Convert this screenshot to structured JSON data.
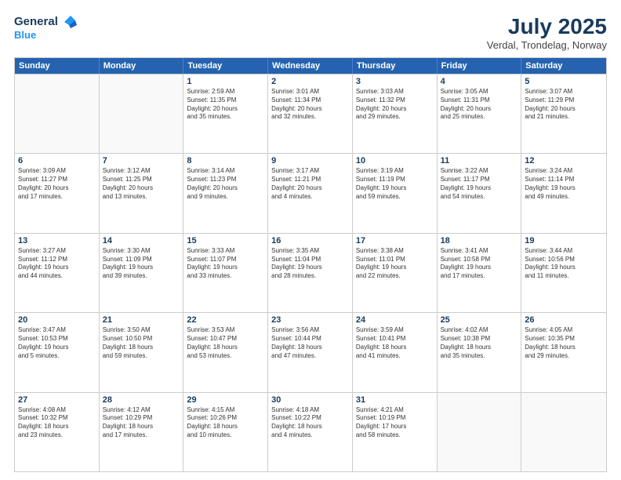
{
  "header": {
    "logo_line1": "General",
    "logo_line2": "Blue",
    "month": "July 2025",
    "location": "Verdal, Trondelag, Norway"
  },
  "weekdays": [
    "Sunday",
    "Monday",
    "Tuesday",
    "Wednesday",
    "Thursday",
    "Friday",
    "Saturday"
  ],
  "weeks": [
    [
      {
        "day": "",
        "text": ""
      },
      {
        "day": "",
        "text": ""
      },
      {
        "day": "1",
        "text": "Sunrise: 2:59 AM\nSunset: 11:35 PM\nDaylight: 20 hours\nand 35 minutes."
      },
      {
        "day": "2",
        "text": "Sunrise: 3:01 AM\nSunset: 11:34 PM\nDaylight: 20 hours\nand 32 minutes."
      },
      {
        "day": "3",
        "text": "Sunrise: 3:03 AM\nSunset: 11:32 PM\nDaylight: 20 hours\nand 29 minutes."
      },
      {
        "day": "4",
        "text": "Sunrise: 3:05 AM\nSunset: 11:31 PM\nDaylight: 20 hours\nand 25 minutes."
      },
      {
        "day": "5",
        "text": "Sunrise: 3:07 AM\nSunset: 11:29 PM\nDaylight: 20 hours\nand 21 minutes."
      }
    ],
    [
      {
        "day": "6",
        "text": "Sunrise: 3:09 AM\nSunset: 11:27 PM\nDaylight: 20 hours\nand 17 minutes."
      },
      {
        "day": "7",
        "text": "Sunrise: 3:12 AM\nSunset: 11:25 PM\nDaylight: 20 hours\nand 13 minutes."
      },
      {
        "day": "8",
        "text": "Sunrise: 3:14 AM\nSunset: 11:23 PM\nDaylight: 20 hours\nand 9 minutes."
      },
      {
        "day": "9",
        "text": "Sunrise: 3:17 AM\nSunset: 11:21 PM\nDaylight: 20 hours\nand 4 minutes."
      },
      {
        "day": "10",
        "text": "Sunrise: 3:19 AM\nSunset: 11:19 PM\nDaylight: 19 hours\nand 59 minutes."
      },
      {
        "day": "11",
        "text": "Sunrise: 3:22 AM\nSunset: 11:17 PM\nDaylight: 19 hours\nand 54 minutes."
      },
      {
        "day": "12",
        "text": "Sunrise: 3:24 AM\nSunset: 11:14 PM\nDaylight: 19 hours\nand 49 minutes."
      }
    ],
    [
      {
        "day": "13",
        "text": "Sunrise: 3:27 AM\nSunset: 11:12 PM\nDaylight: 19 hours\nand 44 minutes."
      },
      {
        "day": "14",
        "text": "Sunrise: 3:30 AM\nSunset: 11:09 PM\nDaylight: 19 hours\nand 39 minutes."
      },
      {
        "day": "15",
        "text": "Sunrise: 3:33 AM\nSunset: 11:07 PM\nDaylight: 19 hours\nand 33 minutes."
      },
      {
        "day": "16",
        "text": "Sunrise: 3:35 AM\nSunset: 11:04 PM\nDaylight: 19 hours\nand 28 minutes."
      },
      {
        "day": "17",
        "text": "Sunrise: 3:38 AM\nSunset: 11:01 PM\nDaylight: 19 hours\nand 22 minutes."
      },
      {
        "day": "18",
        "text": "Sunrise: 3:41 AM\nSunset: 10:58 PM\nDaylight: 19 hours\nand 17 minutes."
      },
      {
        "day": "19",
        "text": "Sunrise: 3:44 AM\nSunset: 10:56 PM\nDaylight: 19 hours\nand 11 minutes."
      }
    ],
    [
      {
        "day": "20",
        "text": "Sunrise: 3:47 AM\nSunset: 10:53 PM\nDaylight: 19 hours\nand 5 minutes."
      },
      {
        "day": "21",
        "text": "Sunrise: 3:50 AM\nSunset: 10:50 PM\nDaylight: 18 hours\nand 59 minutes."
      },
      {
        "day": "22",
        "text": "Sunrise: 3:53 AM\nSunset: 10:47 PM\nDaylight: 18 hours\nand 53 minutes."
      },
      {
        "day": "23",
        "text": "Sunrise: 3:56 AM\nSunset: 10:44 PM\nDaylight: 18 hours\nand 47 minutes."
      },
      {
        "day": "24",
        "text": "Sunrise: 3:59 AM\nSunset: 10:41 PM\nDaylight: 18 hours\nand 41 minutes."
      },
      {
        "day": "25",
        "text": "Sunrise: 4:02 AM\nSunset: 10:38 PM\nDaylight: 18 hours\nand 35 minutes."
      },
      {
        "day": "26",
        "text": "Sunrise: 4:05 AM\nSunset: 10:35 PM\nDaylight: 18 hours\nand 29 minutes."
      }
    ],
    [
      {
        "day": "27",
        "text": "Sunrise: 4:08 AM\nSunset: 10:32 PM\nDaylight: 18 hours\nand 23 minutes."
      },
      {
        "day": "28",
        "text": "Sunrise: 4:12 AM\nSunset: 10:29 PM\nDaylight: 18 hours\nand 17 minutes."
      },
      {
        "day": "29",
        "text": "Sunrise: 4:15 AM\nSunset: 10:26 PM\nDaylight: 18 hours\nand 10 minutes."
      },
      {
        "day": "30",
        "text": "Sunrise: 4:18 AM\nSunset: 10:22 PM\nDaylight: 18 hours\nand 4 minutes."
      },
      {
        "day": "31",
        "text": "Sunrise: 4:21 AM\nSunset: 10:19 PM\nDaylight: 17 hours\nand 58 minutes."
      },
      {
        "day": "",
        "text": ""
      },
      {
        "day": "",
        "text": ""
      }
    ]
  ]
}
